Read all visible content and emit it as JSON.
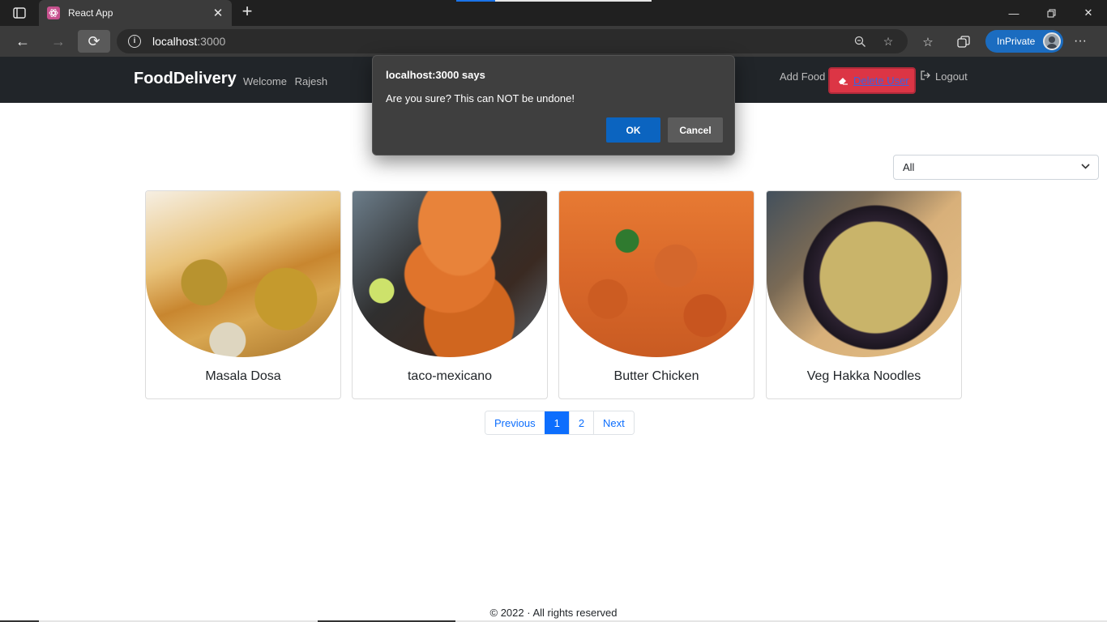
{
  "browser": {
    "tab_title": "React App",
    "url_host": "localhost",
    "url_port": ":3000",
    "inprivate_label": "InPrivate",
    "icons": {
      "sidebar": "tab-actions-icon",
      "favicon": "react-icon",
      "close": "close-icon",
      "new_tab": "plus-icon",
      "back": "arrow-left-icon",
      "forward": "arrow-right-icon",
      "reload": "reload-icon",
      "info": "info-icon",
      "zoom": "zoom-icon",
      "add_favorite": "star-plus-icon",
      "favorites": "favorites-icon",
      "collections": "collections-icon",
      "more": "more-icon"
    }
  },
  "navbar": {
    "brand": "FoodDelivery",
    "welcome_text": "Welcome",
    "user_name": "Rajesh",
    "add_food": "Add Food",
    "delete_user": "Delete User",
    "logout": "Logout"
  },
  "filter": {
    "selected": "All"
  },
  "foods": [
    {
      "name": "Masala Dosa"
    },
    {
      "name": "taco-mexicano"
    },
    {
      "name": "Butter Chicken"
    },
    {
      "name": "Veg Hakka Noodles"
    }
  ],
  "pagination": {
    "previous": "Previous",
    "pages": [
      "1",
      "2"
    ],
    "active_page": "1",
    "next": "Next"
  },
  "footer": {
    "text": "© 2022 · All rights reserved"
  },
  "dialog": {
    "title": "localhost:3000 says",
    "message": "Are you sure? This can NOT be undone!",
    "ok": "OK",
    "cancel": "Cancel"
  },
  "colors": {
    "navbar_bg": "#212529",
    "danger": "#dc3545",
    "primary": "#0d6efd",
    "dialog_bg": "#3f3f3f",
    "dialog_ok": "#0b64c0"
  }
}
